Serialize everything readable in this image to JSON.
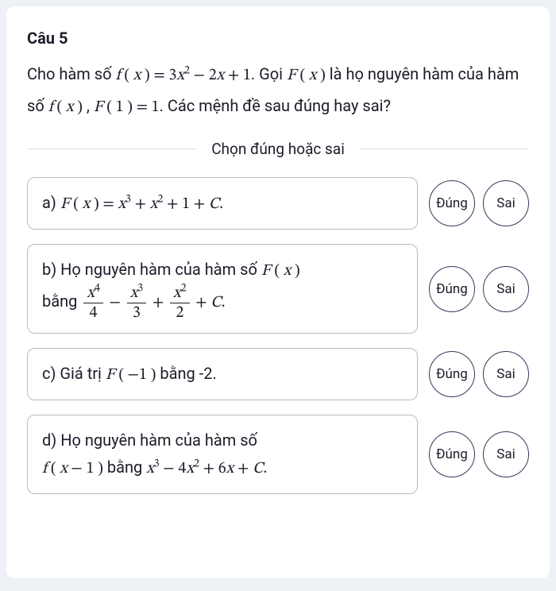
{
  "question": {
    "title": "Câu 5",
    "stem_parts": {
      "p1": "Cho hàm số ",
      "f_eq": "f ( x ) = 3x² − 2x + 1",
      "p2": ". Gọi ",
      "F": "F ( x )",
      "p3": " là họ nguyên hàm của hàm số ",
      "fx": "f ( x )",
      "comma": " , ",
      "cond": "F ( 1 ) = 1",
      "p4": ". Các mệnh đề sau đúng hay sai?"
    }
  },
  "divider": "Chọn đúng hoặc sai",
  "buttons": {
    "true": "Đúng",
    "false": "Sai"
  },
  "options": {
    "a": {
      "label": "a) ",
      "text_before": "",
      "math": "F ( x ) = x³ + x² + 1 + C.",
      "text_after": ""
    },
    "b": {
      "label": "b) ",
      "lead": "Họ nguyên hàm của hàm số ",
      "Fx": "F ( x )",
      "mid": " bằng ",
      "tail": " + C."
    },
    "c": {
      "label": "c) ",
      "lead": "Giá trị ",
      "Fm1": "F ( −1 )",
      "tail": " bằng -2."
    },
    "d": {
      "label": "d) ",
      "lead": "Họ nguyên hàm của hàm số ",
      "fx1": "f ( x − 1 )",
      "mid": " bằng ",
      "poly": "x³ − 4x² + 6x + C.",
      "tail": ""
    }
  }
}
